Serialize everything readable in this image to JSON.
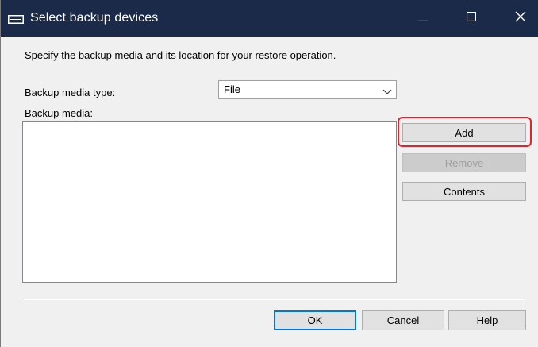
{
  "window": {
    "title": "Select backup devices",
    "icon": "backup-device-icon",
    "controls": {
      "minimize": "minimize-icon",
      "maximize": "maximize-icon",
      "close": "close-icon"
    }
  },
  "instruction": "Specify the backup media and its location for your restore operation.",
  "media_type": {
    "label": "Backup media type:",
    "selected": "File"
  },
  "media_list": {
    "label": "Backup media:",
    "items": []
  },
  "side_buttons": {
    "add": "Add",
    "remove": "Remove",
    "contents": "Contents"
  },
  "footer_buttons": {
    "ok": "OK",
    "cancel": "Cancel",
    "help": "Help"
  },
  "colors": {
    "titlebar": "#1c2a4a",
    "highlight": "#e8202a",
    "default_button_border": "#0078d7"
  }
}
